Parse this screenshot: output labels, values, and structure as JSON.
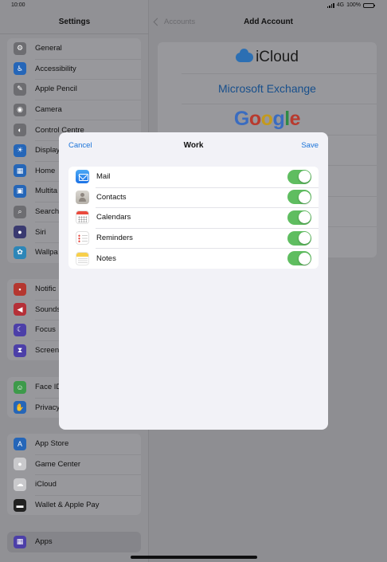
{
  "status_bar": {
    "time": "10:00",
    "network": "4G",
    "battery": "100%",
    "battery_level": 1.0
  },
  "sidebar": {
    "title": "Settings",
    "groups": [
      [
        {
          "label": "General",
          "icon": "gear-icon",
          "color": "#6d6d71"
        },
        {
          "label": "Accessibility",
          "icon": "accessibility-icon",
          "color": "#2566b8"
        },
        {
          "label": "Apple Pencil",
          "icon": "pencil-icon",
          "color": "#6d6d71"
        },
        {
          "label": "Camera",
          "icon": "camera-icon",
          "color": "#6d6d71"
        },
        {
          "label": "Control Centre",
          "icon": "switches-icon",
          "color": "#6d6d71"
        },
        {
          "label": "Display",
          "icon": "brightness-icon",
          "color": "#2566b8"
        },
        {
          "label": "Home",
          "icon": "home-screen-icon",
          "color": "#2566b8"
        },
        {
          "label": "Multita",
          "icon": "multitasking-icon",
          "color": "#2566b8"
        },
        {
          "label": "Search",
          "icon": "search-icon",
          "color": "#6d6d71"
        },
        {
          "label": "Siri",
          "icon": "siri-icon",
          "color": "#3a3a70"
        },
        {
          "label": "Wallpa",
          "icon": "wallpaper-icon",
          "color": "#2d86b8"
        }
      ],
      [
        {
          "label": "Notific",
          "icon": "notifications-icon",
          "color": "#b53730"
        },
        {
          "label": "Sounds",
          "icon": "speaker-icon",
          "color": "#b53038"
        },
        {
          "label": "Focus",
          "icon": "moon-icon",
          "color": "#4c3fa8"
        },
        {
          "label": "Screen",
          "icon": "hourglass-icon",
          "color": "#4c3fa8"
        }
      ],
      [
        {
          "label": "Face ID",
          "icon": "face-id-icon",
          "color": "#3d9a4a"
        },
        {
          "label": "Privacy",
          "icon": "hand-icon",
          "color": "#2566b8"
        }
      ],
      [
        {
          "label": "App Store",
          "icon": "app-store-icon",
          "color": "#2566b8"
        },
        {
          "label": "Game Center",
          "icon": "game-center-icon",
          "color": "#c9c9cc"
        },
        {
          "label": "iCloud",
          "icon": "cloud-icon",
          "color": "#c9c9cc"
        },
        {
          "label": "Wallet & Apple Pay",
          "icon": "wallet-icon",
          "color": "#222222"
        }
      ],
      [
        {
          "label": "Apps",
          "icon": "apps-grid-icon",
          "color": "#4c3fa8",
          "selected": true
        }
      ]
    ]
  },
  "detail": {
    "back_label": "Accounts",
    "title": "Add Account",
    "providers": [
      {
        "label": "iCloud"
      },
      {
        "label": "Microsoft Exchange"
      },
      {
        "label": "Google"
      },
      {
        "label": ""
      },
      {
        "label": ""
      },
      {
        "label": ""
      },
      {
        "label": ""
      }
    ]
  },
  "modal": {
    "cancel_label": "Cancel",
    "title": "Work",
    "save_label": "Save",
    "items": [
      {
        "label": "Mail",
        "icon": "mail-icon",
        "on": true
      },
      {
        "label": "Contacts",
        "icon": "contacts-icon",
        "on": true
      },
      {
        "label": "Calendars",
        "icon": "calendar-icon",
        "on": true
      },
      {
        "label": "Reminders",
        "icon": "reminders-icon",
        "on": true
      },
      {
        "label": "Notes",
        "icon": "notes-icon",
        "on": true
      }
    ]
  },
  "colors": {
    "accent": "#1a73d9",
    "toggle_on": "#5fbd60"
  }
}
